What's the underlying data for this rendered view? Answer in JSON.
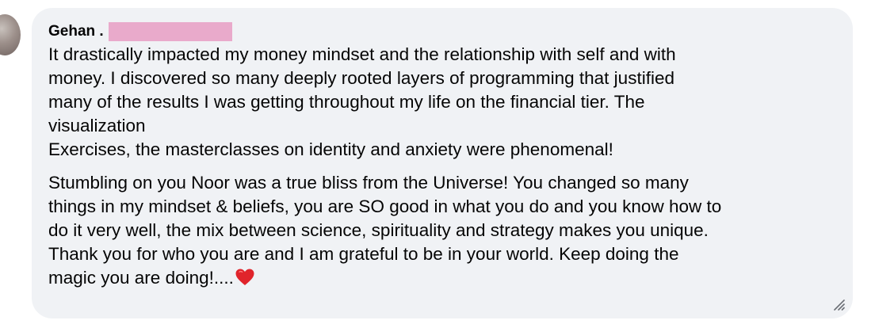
{
  "comment": {
    "author": "Gehan .",
    "paragraph1": [
      "It drastically impacted my money mindset and the relationship with self and with",
      "money. I discovered so many deeply rooted layers of programming that justified",
      "many of the results I was getting throughout my life on the financial tier. The",
      "visualization",
      "Exercises, the masterclasses on identity and anxiety were phenomenal!"
    ],
    "paragraph2": [
      "Stumbling on you Noor was a true bliss from the Universe! You changed so many",
      "things in my mindset & beliefs, you are SO good in what you do and you know how to",
      "do it very well, the mix between science, spirituality and strategy makes you unique.",
      "Thank you for who you are and I am grateful to be in your world. Keep doing the",
      "magic you are doing!...."
    ],
    "emoji": "heart-emoji",
    "redaction_color": "#e9aacb",
    "bubble_color": "#f0f2f5"
  },
  "icons": {
    "avatar": "avatar",
    "resize": "resize-handle-icon"
  }
}
